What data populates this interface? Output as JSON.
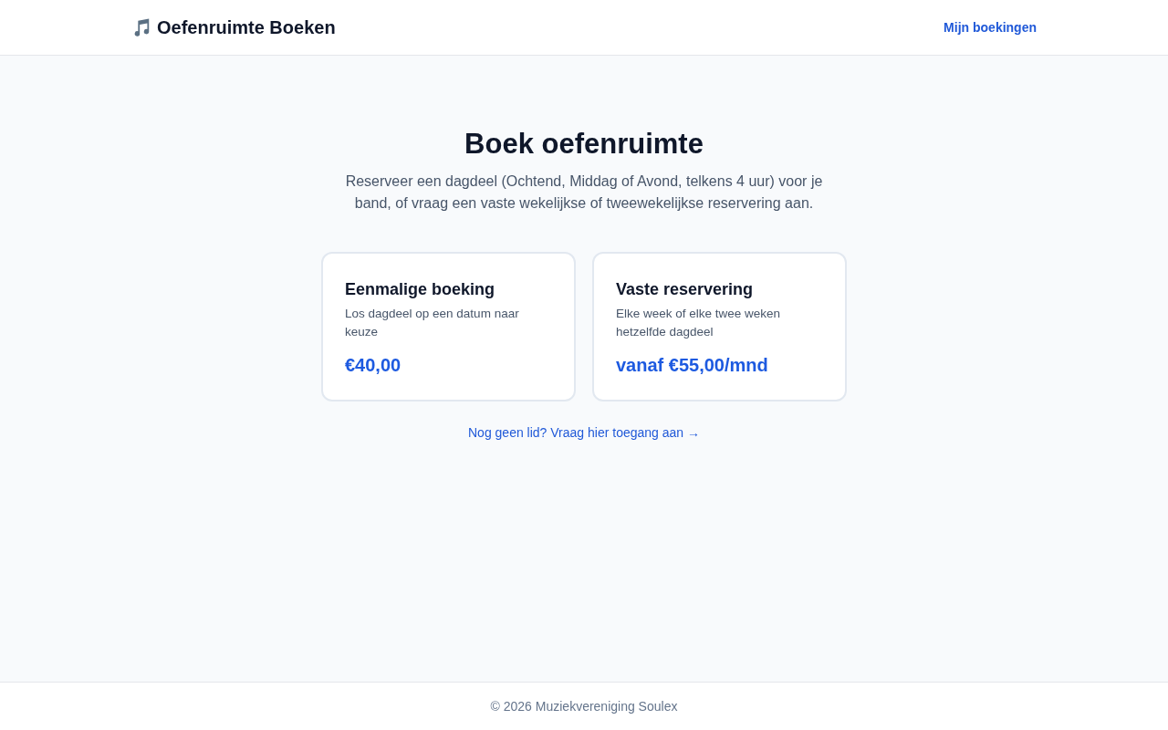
{
  "header": {
    "title": "Oefenruimte Boeken",
    "nav_link": "Mijn boekingen"
  },
  "intro": {
    "heading": "Boek oefenruimte",
    "text": "Reserveer een dagdeel (Ochtend, Middag of Avond, telkens 4 uur) voor je band, of vraag een vaste wekelijkse of tweewekelijkse reservering aan."
  },
  "options": [
    {
      "title": "Eenmalige boeking",
      "description": "Los dagdeel op een datum naar keuze",
      "price": "€40,00"
    },
    {
      "title": "Vaste reservering",
      "description": "Elke week of elke twee weken hetzelfde dagdeel",
      "price": "vanaf €55,00/mnd"
    }
  ],
  "access_link": "Nog geen lid? Vraag hier toegang aan →",
  "footer": {
    "text": "© 2026 Muziekvereniging Soulex"
  }
}
